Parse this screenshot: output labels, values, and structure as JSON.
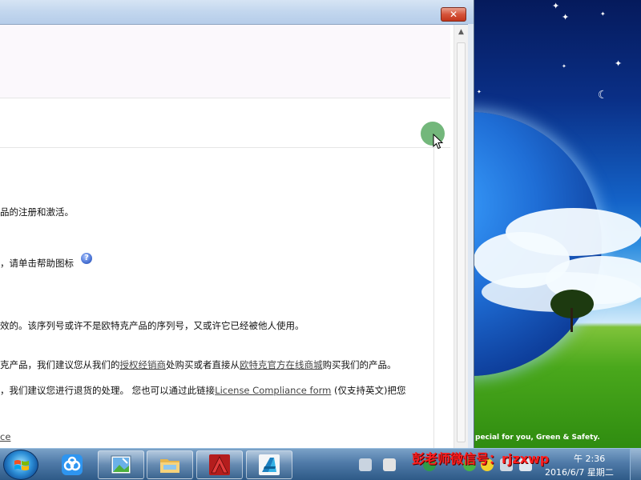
{
  "window": {
    "close_glyph": "✕",
    "lines": {
      "l1": "品的注册和激活。",
      "l2": "，请单击帮助图标",
      "l3": "效的。该序列号或许不是欧特克产品的序列号，又或许它已经被他人使用。",
      "l4_prefix": "克产品，我们建议您从我们的",
      "l4_link1": "授权经销商",
      "l4_mid": "处购买或者直接从",
      "l4_link2": "欧特克官方在线商城",
      "l4_suffix": "购买我们的产品。",
      "l5_prefix": "，我们建议您进行退货的处理。  您也可以通过此链接",
      "l5_link": "License Compliance form",
      "l5_suffix": " (仅支持英文)把您",
      "l6_link": "ce"
    },
    "help_icon_glyph": "?"
  },
  "wallpaper": {
    "caption": "pecial for you, Green & Safety."
  },
  "taskbar": {
    "clock_time": "午 2:36",
    "clock_date": "2016/6/7 星期二",
    "watermark": "彭老师微信号：rjzxwp"
  },
  "colors": {
    "accent": "#2e5a87",
    "link": "#444444",
    "watermark": "#ff1e1e"
  }
}
